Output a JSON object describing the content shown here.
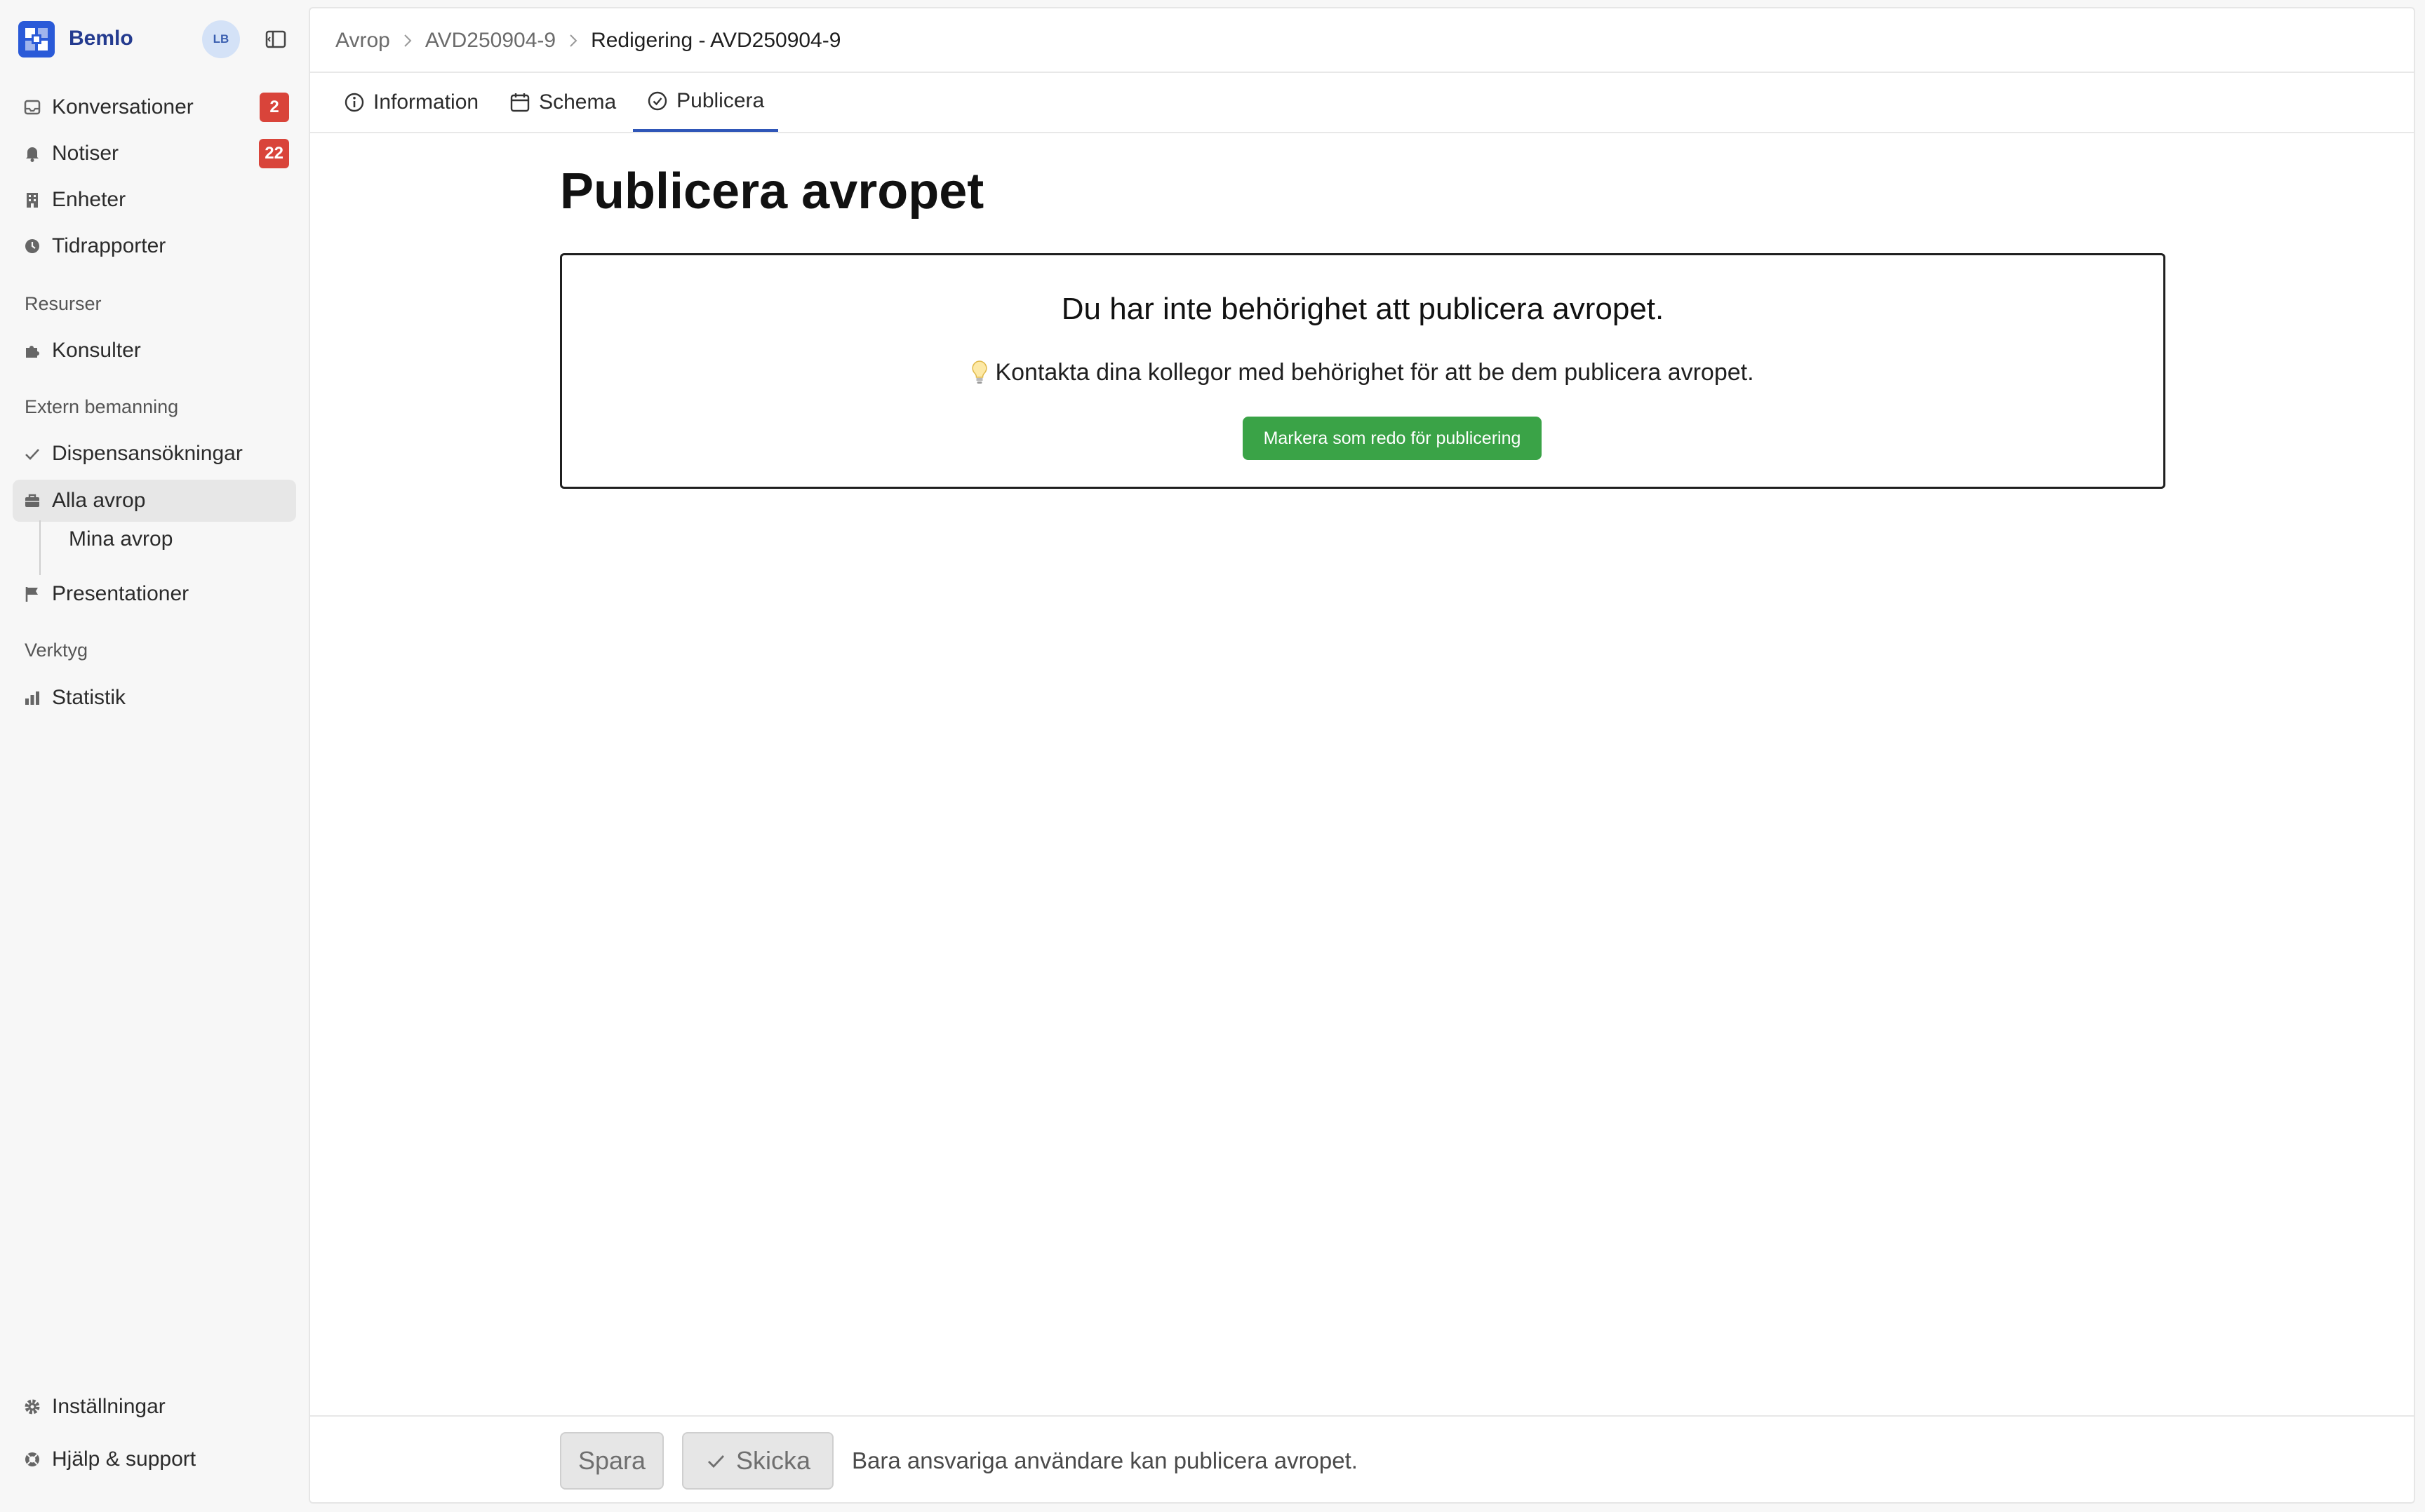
{
  "app": {
    "name": "Bemlo",
    "user_initials": "LB"
  },
  "sidebar": {
    "items": [
      {
        "label": "Konversationer",
        "badge": "2",
        "icon": "inbox-icon"
      },
      {
        "label": "Notiser",
        "badge": "22",
        "icon": "bell-icon"
      },
      {
        "label": "Enheter",
        "icon": "building-icon"
      },
      {
        "label": "Tidrapporter",
        "icon": "clock-icon"
      }
    ],
    "sections": {
      "resources": {
        "title": "Resurser",
        "items": [
          {
            "label": "Konsulter",
            "icon": "puzzle-icon"
          }
        ]
      },
      "external": {
        "title": "Extern bemanning",
        "items": [
          {
            "label": "Dispensansökningar",
            "icon": "check-icon"
          },
          {
            "label": "Alla avrop",
            "icon": "briefcase-icon",
            "active": true
          },
          {
            "label": "Mina avrop"
          },
          {
            "label": "Presentationer",
            "icon": "flag-icon"
          }
        ]
      },
      "tools": {
        "title": "Verktyg",
        "items": [
          {
            "label": "Statistik",
            "icon": "bar-chart-icon"
          }
        ]
      }
    },
    "footer": [
      {
        "label": "Inställningar",
        "icon": "gear-icon"
      },
      {
        "label": "Hjälp & support",
        "icon": "lifebuoy-icon"
      }
    ]
  },
  "breadcrumb": {
    "root": "Avrop",
    "parent": "AVD250904-9",
    "current": "Redigering - AVD250904-9"
  },
  "tabs": [
    {
      "label": "Information",
      "icon": "info-icon"
    },
    {
      "label": "Schema",
      "icon": "calendar-icon"
    },
    {
      "label": "Publicera",
      "icon": "check-circle-icon",
      "active": true
    }
  ],
  "main": {
    "title": "Publicera avropet",
    "notice": {
      "heading": "Du har inte behörighet att publicera avropet.",
      "text": "Kontakta dina kollegor med behörighet för att be dem publicera avropet.",
      "button": "Markera som redo för publicering"
    }
  },
  "footer_bar": {
    "save_label": "Spara",
    "send_label": "Skicka",
    "note": "Bara ansvariga användare kan publicera avropet."
  },
  "colors": {
    "brand": "#2a5ad8",
    "badge": "#d9443a",
    "ready_button": "#3aa347",
    "active_tab": "#2f56b8"
  }
}
